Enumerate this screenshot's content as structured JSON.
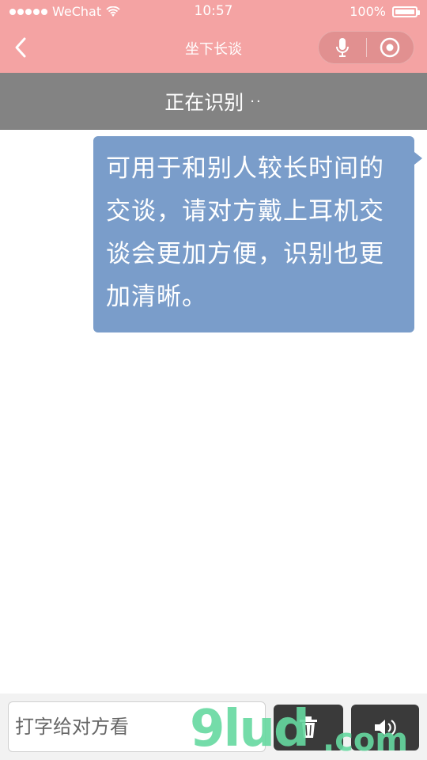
{
  "status_bar": {
    "carrier": "WeChat",
    "time": "10:57",
    "battery": "100%",
    "signal_icon": "signal-dots-icon",
    "wifi_icon": "wifi-icon",
    "battery_icon": "battery-icon"
  },
  "nav": {
    "title": "坐下长谈",
    "back_icon": "chevron-left-icon",
    "mic_icon": "microphone-icon",
    "close_icon": "target-circle-icon"
  },
  "banner": {
    "text": "正在识别",
    "dots": "··"
  },
  "message": {
    "text": "可用于和别人较长时间的交谈，请对方戴上耳机交谈会更加方便，识别也更加清晰。"
  },
  "input_bar": {
    "placeholder": "打字给对方看",
    "value": "",
    "delete_icon": "trash-icon",
    "speaker_icon": "speaker-icon"
  },
  "watermark": {
    "main": "9lud",
    "domain": ".com"
  },
  "colors": {
    "header": "#f4a3a3",
    "banner": "#838383",
    "bubble": "#7a9dca",
    "button_dark": "#3a3a3a"
  }
}
